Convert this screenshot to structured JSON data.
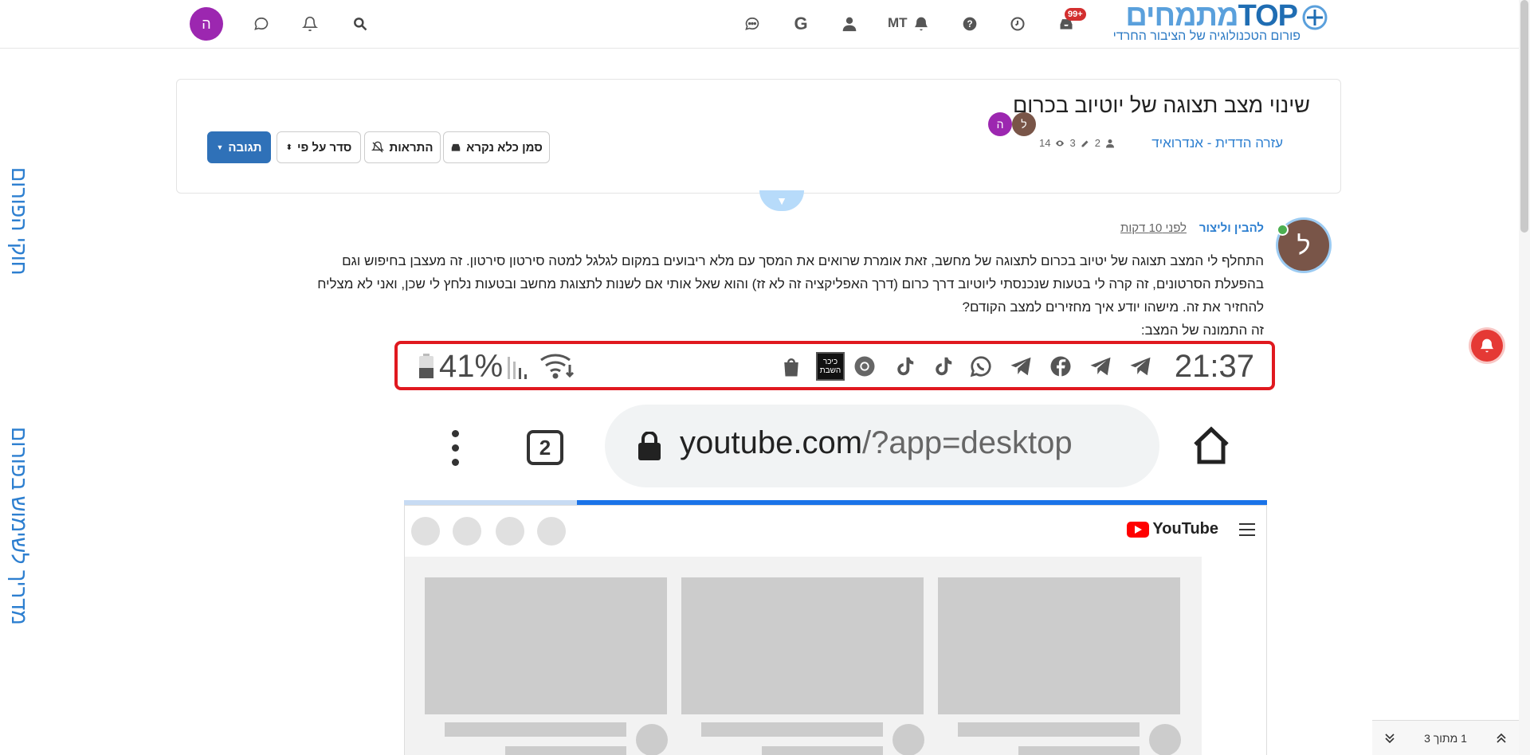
{
  "header": {
    "user_initial": "ה",
    "notif_badge": "99+",
    "mt_label": "MT",
    "logo": {
      "brand_top": "TOP",
      "brand_heb": "מתמחים",
      "tagline": "פורום הטכנולוגיה של הציבור החרדי"
    },
    "icons": [
      "search-icon",
      "bell-icon",
      "chat-icon",
      "inbox-icon",
      "clock-icon",
      "help-icon",
      "bell-icon",
      "user-icon",
      "google-icon",
      "chats-icon"
    ]
  },
  "sidebar": {
    "rules_label": "חוקי הפורום",
    "guide_label": "מדריך לשימוש בפורום"
  },
  "topic": {
    "title": "שינוי מצב תצוגה של יוטיוב בכרום",
    "category": "עזרה הדדית - אנדרואיד",
    "posters": "2",
    "posts": "3",
    "views": "14",
    "participants": [
      {
        "initial": "ל",
        "color": "#795548"
      },
      {
        "initial": "ה",
        "color": "#9c27b0"
      }
    ],
    "buttons": {
      "reply": "תגובה",
      "sort": "סדר על פי",
      "notifications": "התראות",
      "mark_unread": "סמן כלא נקרא"
    }
  },
  "post": {
    "author": "להבין וליצור",
    "author_initial": "ל",
    "time": "לפני 10 דקות",
    "lines": [
      "התחלף לי המצב תצוגה של יטיוב בכרום לתצוגה של מחשב, זאת אומרת שרואים את המסך עם מלא ריבועים במקום לגלגל למטה סירטון סירטון. זה מעצבן בחיפוש וגם",
      "בהפעלת הסרטונים, זה קרה לי בטעות שנכנסתי ליוטיוב דרך כרום (דרך האפליקציה זה לא זז) והוא שאל אותי אם לשנות לתצוגת מחשב ובטעות נלחץ לי שכן, ואני לא מצליח",
      "להחזיר את זה. מישהו יודע איך מחזירים למצב הקודם?",
      "זה התמונה של המצב:"
    ]
  },
  "screenshot": {
    "battery_pct": "41%",
    "time": "21:37",
    "news_app_label": "כיכר השבת",
    "tab_count": "2",
    "url_host": "youtube.com",
    "url_path": "/?app=desktop",
    "youtube_label": "YouTube",
    "load_progress": 0.8
  },
  "pager": {
    "label": "1 מתוך 3"
  }
}
